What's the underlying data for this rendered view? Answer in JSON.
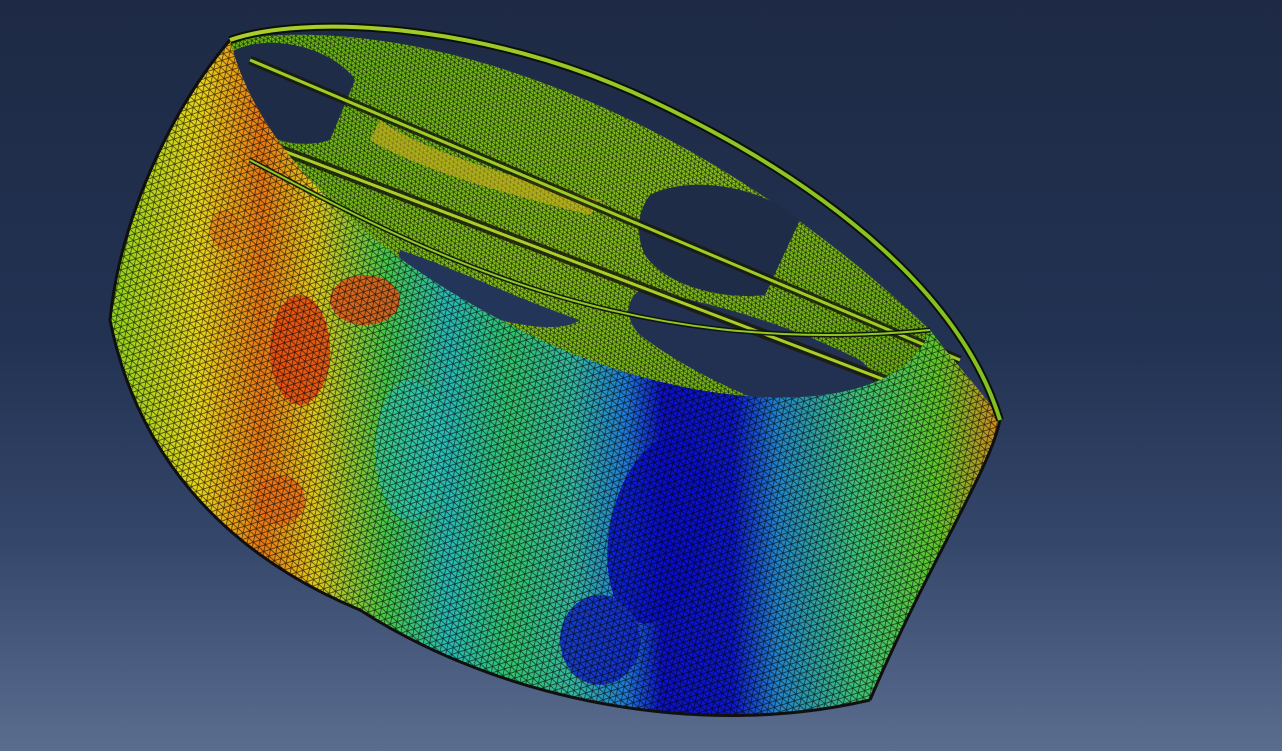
{
  "viewport": {
    "background_top": "#1e2a45",
    "background_bottom": "#5b6d8f"
  },
  "model": {
    "kind": "fea-contour-plot",
    "shape": "cylindrical-ring-with-slots",
    "mesh": "triangular",
    "mesh_visible": true,
    "contour_colors": [
      "#0a10c8",
      "#1a6fd8",
      "#27c6d4",
      "#28c86a",
      "#6fd21f",
      "#d8e01e",
      "#f0a81a",
      "#e64a14",
      "#d82a10"
    ],
    "mesh_edge_color": "#000000"
  }
}
